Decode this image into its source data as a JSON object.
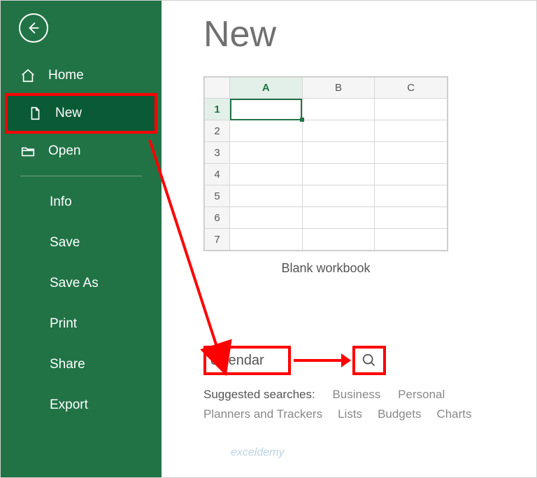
{
  "sidebar": {
    "back": "Back",
    "nav": [
      {
        "label": "Home"
      },
      {
        "label": "New"
      },
      {
        "label": "Open"
      }
    ],
    "sub": [
      {
        "label": "Info"
      },
      {
        "label": "Save"
      },
      {
        "label": "Save As"
      },
      {
        "label": "Print"
      },
      {
        "label": "Share"
      },
      {
        "label": "Export"
      }
    ]
  },
  "main": {
    "title": "New",
    "template_label": "Blank workbook",
    "grid": {
      "cols": [
        "A",
        "B",
        "C"
      ],
      "rows": [
        "1",
        "2",
        "3",
        "4",
        "5",
        "6",
        "7"
      ]
    },
    "search_value": "calendar",
    "suggested_label": "Suggested searches:",
    "suggested": [
      "Business",
      "Personal",
      "Planners and Trackers",
      "Lists",
      "Budgets",
      "Charts"
    ]
  },
  "watermark": "exceldemy"
}
